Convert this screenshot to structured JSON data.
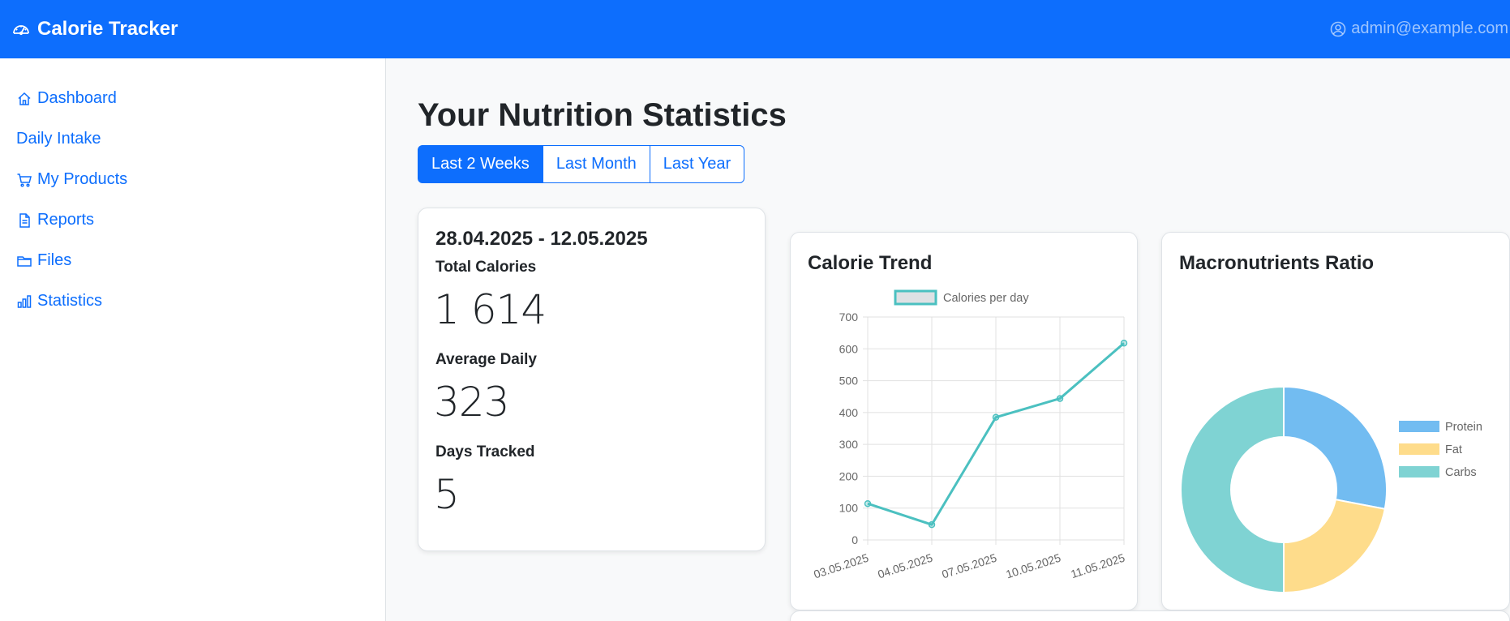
{
  "app": {
    "title": "Calorie Tracker",
    "user": "admin@example.com"
  },
  "sidebar": {
    "items": [
      {
        "label": "Dashboard",
        "icon": "house-icon"
      },
      {
        "label": "Daily Intake",
        "icon": ""
      },
      {
        "label": "My Products",
        "icon": "cart-icon"
      },
      {
        "label": "Reports",
        "icon": "document-icon"
      },
      {
        "label": "Files",
        "icon": "folder-icon"
      },
      {
        "label": "Statistics",
        "icon": "bar-chart-icon"
      }
    ]
  },
  "main": {
    "title": "Your Nutrition Statistics",
    "periods": [
      "Last 2 Weeks",
      "Last Month",
      "Last Year"
    ],
    "active_period": "Last 2 Weeks"
  },
  "summary": {
    "range": "28.04.2025 - 12.05.2025",
    "total_label": "Total Calories",
    "total_value": "1 614",
    "avg_label": "Average Daily",
    "avg_value": "323",
    "days_label": "Days Tracked",
    "days_value": "5"
  },
  "colors": {
    "primary": "#0d6efd",
    "teal": "#4bc0c0",
    "blue": "#36a2eb",
    "yellow": "#ffcd56"
  },
  "chart_data": [
    {
      "title": "Calorie Trend",
      "type": "line",
      "series": [
        {
          "name": "Calories per day",
          "values": [
            114,
            48,
            385,
            444,
            618
          ]
        }
      ],
      "x": [
        "03.05.2025",
        "04.05.2025",
        "07.05.2025",
        "10.05.2025",
        "11.05.2025"
      ],
      "ylim": [
        0,
        700
      ],
      "yticks": [
        0,
        100,
        200,
        300,
        400,
        500,
        600,
        700
      ],
      "grid": true,
      "legend": "top",
      "xlabel": "",
      "ylabel": ""
    },
    {
      "title": "Macronutrients Ratio",
      "type": "pie",
      "categories": [
        "Protein",
        "Fat",
        "Carbs"
      ],
      "values": [
        28,
        22,
        50
      ],
      "colors": [
        "#72bcf1",
        "#fedc8b",
        "#7fd3d3"
      ],
      "legend": "right"
    }
  ]
}
